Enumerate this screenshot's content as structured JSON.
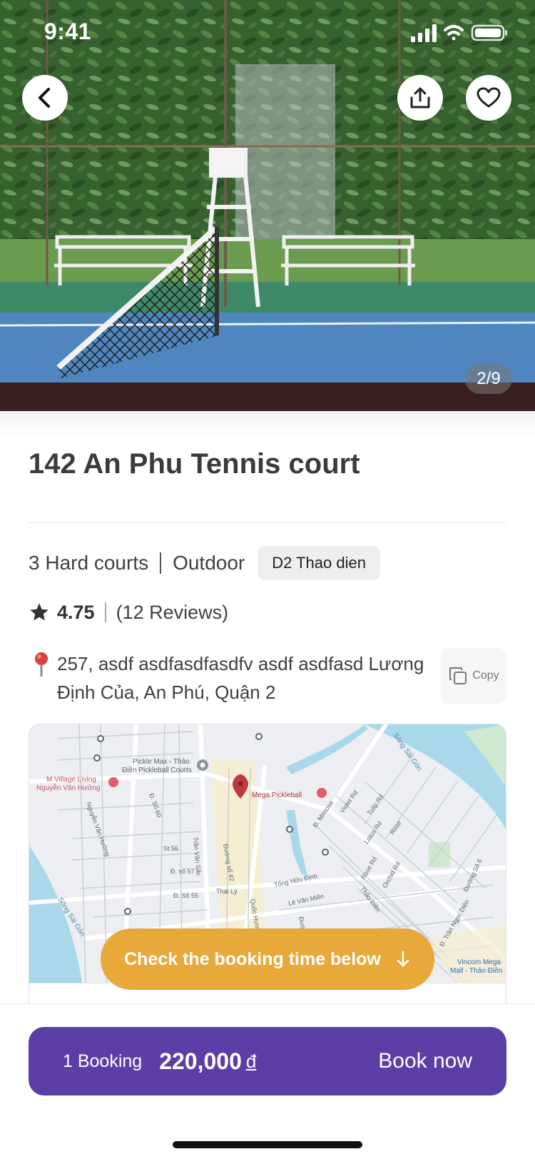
{
  "status_bar": {
    "time": "9:41"
  },
  "hero": {
    "image_counter": "2/9"
  },
  "venue": {
    "title": "142 An Phu Tennis court",
    "courts": "3 Hard courts",
    "environment": "Outdoor",
    "district_tag": "D2 Thao dien",
    "rating": "4.75",
    "reviews": "(12 Reviews)",
    "address": "257, asdf asdfasdfasdfv asdf asdfasd Lương Định Của, An Phú, Quận 2",
    "copy_label": "Copy"
  },
  "map": {
    "labels": {
      "pickle_max": "Pickle Max - Thảo Điền Pickleball Courts",
      "village": "M Village Living Nguyễn Văn Hưởng",
      "mega_pickleball": "Mega Pickleball",
      "vincom": "Vincom Mega Mall - Thảo Điền",
      "song_sai_gon_1": "Sông Sài Gòn",
      "song_sai_gon_2": "Sông Sài Gòn",
      "st_nguyen_van_huong": "Nguyễn Văn Hưởng",
      "st_tran_van_sac": "Trần Văn Sắc",
      "st_so60": "Đ. Số 60",
      "st_so42": "Đường số 42",
      "st_thai_ly": "Thái Lý",
      "st_le_van_mien": "Lê Văn Miến",
      "st_tong_huu_dinh": "Tống Hữu Định",
      "st_thao_dien": "Thảo Điền",
      "st_quoc_huong": "Quốc Hương",
      "st_so55": "Đ. Số 55",
      "st_so57": "Đ. số 57",
      "st_st56": "St 56",
      "st_mimosa": "Đ. Mimosa",
      "st_violet": "Violet Rd",
      "st_tulip": "Tulip Rd",
      "st_lotus": "Lotus Rd",
      "st_rose": "Rose",
      "st_rose_rd": "Rose Rd",
      "st_orchid": "Orchid Rd",
      "st_tran_ngoc_dien": "Đ. Trần Ngọc Diện",
      "st_so6": "Đường Số 6",
      "st_so": "Đường số"
    }
  },
  "cta": {
    "check_booking": "Check the booking time below"
  },
  "booking": {
    "count_label": "1 Booking",
    "price": "220,000",
    "currency": "đ",
    "book_now": "Book now"
  },
  "colors": {
    "primary": "#5b3fa6",
    "accent": "#e8a83a",
    "map_pin": "#c0393f"
  },
  "icons": [
    "back-icon",
    "share-icon",
    "heart-icon",
    "star-icon",
    "pin-icon",
    "copy-icon",
    "arrow-down-icon",
    "signal-icon",
    "wifi-icon",
    "battery-icon"
  ]
}
